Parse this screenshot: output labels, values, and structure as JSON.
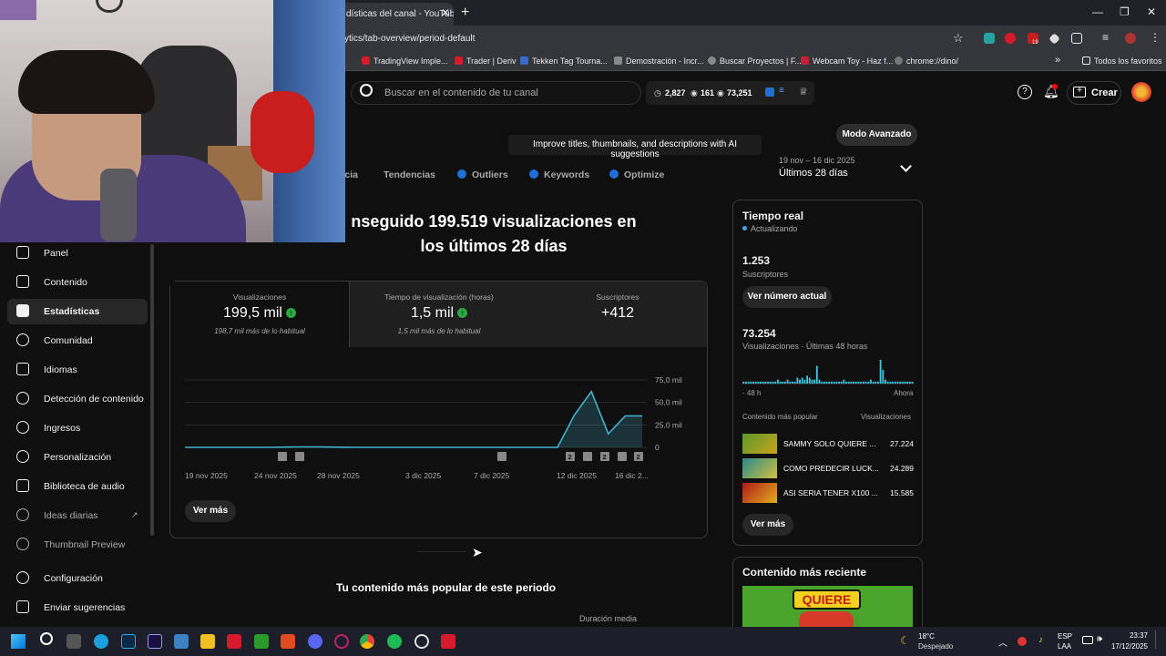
{
  "browser": {
    "tab_title": "dísticas del canal - YouTube",
    "url": "ytics/tab-overview/period-default",
    "bookmarks": [
      "TradingView Imple...",
      "Trader | Deriv",
      "Tekken Tag Tourna...",
      "Demostración - Incr...",
      "Buscar Proyectos | F...",
      "Webcam Toy - Haz f...",
      "chrome://dino/"
    ],
    "bookmarks_overflow": "»",
    "all_bookmarks": "Todos los favoritos",
    "ext_badge": "19"
  },
  "header": {
    "search_placeholder": "Buscar en el contenido de tu canal",
    "stat1": "2,827",
    "stat2": "161",
    "stat3": "73,251",
    "create_label": "Crear"
  },
  "banner": {
    "ai_tip": "Improve titles, thumbnails, and descriptions with AI suggestions",
    "mode_button": "Modo Avanzado"
  },
  "subtabs": {
    "partial": "ncia",
    "trends": "Tendencias",
    "outliers": "Outliers",
    "keywords": "Keywords",
    "optimize": "Optimize"
  },
  "period": {
    "range": "19 nov – 16 dic 2025",
    "label": "Últimos 28 días"
  },
  "sidebar": {
    "items": [
      {
        "label": "Panel"
      },
      {
        "label": "Contenido"
      },
      {
        "label": "Estadísticas"
      },
      {
        "label": "Comunidad"
      },
      {
        "label": "Idiomas"
      },
      {
        "label": "Detección de contenido"
      },
      {
        "label": "Ingresos"
      },
      {
        "label": "Personalización"
      },
      {
        "label": "Biblioteca de audio"
      },
      {
        "label": "Ideas diarias"
      },
      {
        "label": "Thumbnail Preview"
      }
    ],
    "settings": "Configuración",
    "feedback": "Enviar sugerencias"
  },
  "overview": {
    "headline": "nseguido 199.519 visualizaciones en los últimos 28 días",
    "metrics": [
      {
        "label": "Visualizaciones",
        "value": "199,5 mil",
        "note": "198,7 mil más de lo habitual"
      },
      {
        "label": "Tiempo de visualización (horas)",
        "value": "1,5 mil",
        "note": "1,5 mil más de lo habitual"
      },
      {
        "label": "Suscriptores",
        "value": "+412",
        "note": ""
      }
    ],
    "more_button": "Ver más",
    "popular_heading": "Tu contenido más popular de este periodo",
    "avg_duration": "Duración media"
  },
  "chart_data": {
    "type": "line",
    "x_ticks": [
      "19 nov 2025",
      "24 nov 2025",
      "28 nov 2025",
      "3 dic 2025",
      "7 dic 2025",
      "12 dic 2025",
      "16 dic 2..."
    ],
    "y_ticks": [
      "75,0 mil",
      "50,0 mil",
      "25,0 mil",
      "0"
    ],
    "ylim": [
      0,
      75000
    ],
    "series": [
      {
        "values": [
          0,
          0,
          0,
          0,
          0,
          0,
          300,
          500,
          400,
          200,
          0,
          0,
          0,
          0,
          0,
          0,
          0,
          0,
          0,
          0,
          0,
          0,
          0,
          36000,
          62000,
          15000,
          35000,
          35000
        ]
      }
    ],
    "marker_badges": [
      "2",
      "2",
      "2"
    ],
    "line_color": "#41b4d2"
  },
  "realtime": {
    "title": "Tiempo real",
    "updating": "Actualizando",
    "subs_value": "1.253",
    "subs_label": "Suscriptores",
    "current_button": "Ver número actual",
    "views_value": "73.254",
    "views_label": "Visualizaciones · Últimas 48 horas",
    "axis_left": "- 48 h",
    "axis_right": "Ahora",
    "top_label": "Contenido más popular",
    "top_col": "Visualizaciones",
    "videos": [
      {
        "title": "SAMMY SOLO QUIERE ...",
        "views": "27.224"
      },
      {
        "title": "COMO PREDECIR LUCK...",
        "views": "24.289"
      },
      {
        "title": "ASI SERIA TENER X100 ...",
        "views": "15.585"
      }
    ],
    "more_button": "Ver más",
    "bars": [
      1,
      1,
      1,
      1,
      1,
      1,
      1,
      1,
      1,
      1,
      1,
      1,
      1,
      1,
      2,
      1,
      1,
      1,
      2,
      1,
      1,
      1,
      3,
      2,
      3,
      2,
      4,
      3,
      2,
      2,
      9,
      2,
      1,
      1,
      1,
      1,
      1,
      1,
      1,
      1,
      1,
      2,
      1,
      1,
      1,
      1,
      1,
      1,
      1,
      1,
      1,
      1,
      2,
      1,
      1,
      1,
      12,
      7,
      2,
      1,
      1,
      1,
      1,
      1,
      1,
      1,
      1,
      1,
      1,
      1
    ]
  },
  "recent": {
    "title": "Contenido más reciente",
    "thumb_text": "QUIERE"
  },
  "taskbar": {
    "weather_temp": "18°C",
    "weather_desc": "Despejado",
    "lang": "ESP",
    "lang2": "LAA",
    "time": "23:37",
    "date": "17/12/2025"
  }
}
